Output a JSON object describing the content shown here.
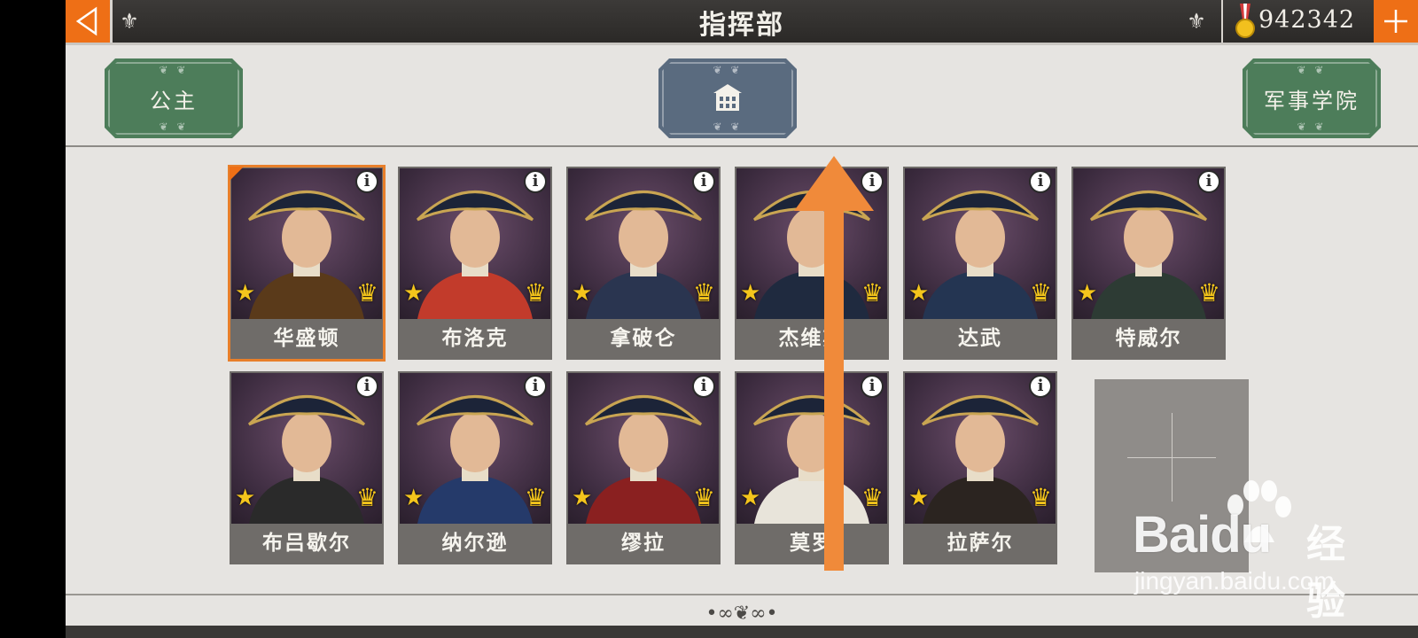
{
  "header": {
    "title": "指挥部",
    "gold": "942342"
  },
  "nav": {
    "left_label": "公主",
    "center_icon": "building-icon",
    "right_label": "军事学院"
  },
  "generals": [
    {
      "name": "华盛顿",
      "selected": true
    },
    {
      "name": "布洛克",
      "selected": false
    },
    {
      "name": "拿破仑",
      "selected": false
    },
    {
      "name": "杰维斯",
      "selected": false
    },
    {
      "name": "达武",
      "selected": false
    },
    {
      "name": "特威尔",
      "selected": false
    },
    {
      "name": "布吕歇尔",
      "selected": false
    },
    {
      "name": "纳尔逊",
      "selected": false
    },
    {
      "name": "缪拉",
      "selected": false
    },
    {
      "name": "莫罗",
      "selected": false
    },
    {
      "name": "拉萨尔",
      "selected": false
    }
  ],
  "watermark": {
    "brand": "Baidu",
    "cn": "经验",
    "url": "jingyan.baidu.com"
  },
  "colors": {
    "accent": "#ee6f16",
    "green_button": "#4d7d5a",
    "slate_button": "#5a6b7f",
    "arrow": "#f08a3a"
  }
}
